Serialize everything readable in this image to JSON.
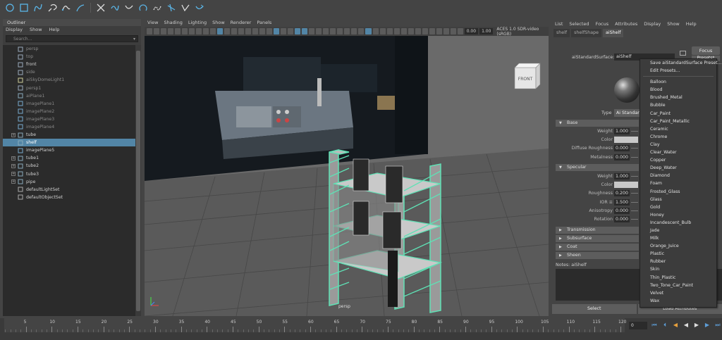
{
  "outliner": {
    "title": "Outliner",
    "menu": [
      "Display",
      "Show",
      "Help"
    ],
    "search_placeholder": "Search...",
    "items": [
      {
        "label": "persp",
        "dim": true,
        "icon": "camera-icon",
        "expand": false
      },
      {
        "label": "top",
        "dim": true,
        "icon": "camera-icon",
        "expand": false
      },
      {
        "label": "front",
        "dim": false,
        "icon": "camera-icon",
        "expand": false
      },
      {
        "label": "side",
        "dim": true,
        "icon": "camera-icon",
        "expand": false
      },
      {
        "label": "aiSkyDomeLight1",
        "dim": true,
        "icon": "light-icon",
        "expand": false
      },
      {
        "label": "persp1",
        "dim": true,
        "icon": "camera-icon",
        "expand": false
      },
      {
        "label": "aiPlane1",
        "dim": true,
        "icon": "mesh-icon",
        "expand": false
      },
      {
        "label": "imagePlane1",
        "dim": true,
        "icon": "image-plane-icon",
        "expand": false
      },
      {
        "label": "imagePlane2",
        "dim": true,
        "icon": "image-plane-icon",
        "expand": false
      },
      {
        "label": "imagePlane3",
        "dim": true,
        "icon": "image-plane-icon",
        "expand": false
      },
      {
        "label": "imagePlane4",
        "dim": true,
        "icon": "image-plane-icon",
        "expand": false
      },
      {
        "label": "tube",
        "dim": false,
        "icon": "mesh-icon",
        "expand": true
      },
      {
        "label": "shelf",
        "dim": false,
        "icon": "mesh-icon",
        "expand": false,
        "selected": true
      },
      {
        "label": "imagePlane5",
        "dim": false,
        "icon": "image-plane-icon",
        "expand": false
      },
      {
        "label": "tube1",
        "dim": false,
        "icon": "mesh-icon",
        "expand": true
      },
      {
        "label": "tube2",
        "dim": false,
        "icon": "mesh-icon",
        "expand": true
      },
      {
        "label": "tube3",
        "dim": false,
        "icon": "mesh-icon",
        "expand": true
      },
      {
        "label": "pipe",
        "dim": false,
        "icon": "mesh-icon",
        "expand": true
      },
      {
        "label": "defaultLightSet",
        "dim": false,
        "icon": "set-icon",
        "expand": false
      },
      {
        "label": "defaultObjectSet",
        "dim": false,
        "icon": "set-icon",
        "expand": false
      }
    ]
  },
  "viewport": {
    "menu": [
      "View",
      "Shading",
      "Lighting",
      "Show",
      "Renderer",
      "Panels"
    ],
    "field_a": "0.00",
    "field_b": "1.00",
    "color_space": "ACES 1.0 SDR-video (sRGB)",
    "camera_label": "persp",
    "viewcube_label": "FRONT"
  },
  "attribute_editor": {
    "menu": [
      "List",
      "Selected",
      "Focus",
      "Attributes",
      "Display",
      "Show",
      "Help"
    ],
    "tabs": [
      "shelf",
      "shelfShape",
      "aiShelf"
    ],
    "active_tab": 2,
    "node_label": "aiStandardSurface:",
    "node_value": "aiShelf",
    "focus_label": "Focus",
    "presets_label": "Presets*",
    "type_label": "Type",
    "type_value": "Ai Standard Surface",
    "base_section": "Base",
    "base_rows": [
      {
        "label": "Weight",
        "value": "1.000"
      },
      {
        "label": "Color",
        "value": ""
      },
      {
        "label": "Diffuse Roughness",
        "value": "0.000"
      },
      {
        "label": "Metalness",
        "value": "0.000"
      }
    ],
    "specular_section": "Specular",
    "specular_rows": [
      {
        "label": "Weight",
        "value": "1.000"
      },
      {
        "label": "Color",
        "value": ""
      },
      {
        "label": "Roughness",
        "value": "0.200"
      },
      {
        "label": "IOR ≡",
        "value": "1.500"
      },
      {
        "label": "Anisotropy",
        "value": "0.000"
      },
      {
        "label": "Rotation",
        "value": "0.000"
      }
    ],
    "collapsed_sections": [
      "Transmission",
      "Subsurface",
      "Coat",
      "Sheen"
    ],
    "notes_label": "Notes: aiShelf",
    "select_button": "Select",
    "load_button": "Load Attributes"
  },
  "presets_menu": {
    "top_items": [
      "Save aiStandardSurface Preset...",
      "Edit Presets..."
    ],
    "items": [
      "Balloon",
      "Blood",
      "Brushed_Metal",
      "Bubble",
      "Car_Paint",
      "Car_Paint_Metallic",
      "Ceramic",
      "Chrome",
      "Clay",
      "Clear_Water",
      "Copper",
      "Deep_Water",
      "Diamond",
      "Foam",
      "Frosted_Glass",
      "Glass",
      "Gold",
      "Honey",
      "Incandescent_Bulb",
      "Jade",
      "Milk",
      "Orange_Juice",
      "Plastic",
      "Rubber",
      "Skin",
      "Thin_Plastic",
      "Two_Tone_Car_Paint",
      "Velvet",
      "Wax"
    ]
  },
  "timeline": {
    "ticks": [
      "5",
      "10",
      "15",
      "20",
      "25",
      "30",
      "35",
      "40",
      "45",
      "50",
      "55",
      "60",
      "65",
      "70",
      "75",
      "80",
      "85",
      "90",
      "95",
      "100",
      "105",
      "110",
      "115",
      "120"
    ],
    "current_frame": "0"
  }
}
